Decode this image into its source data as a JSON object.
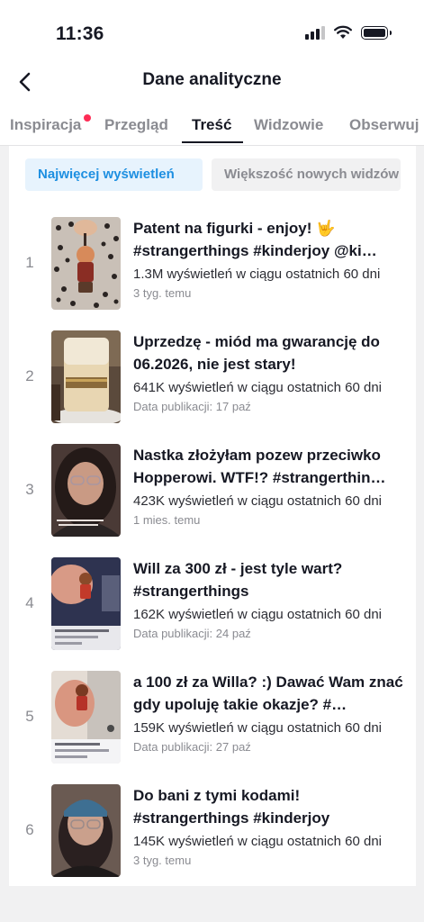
{
  "status": {
    "time": "11:36"
  },
  "header": {
    "title": "Dane analityczne"
  },
  "tabs": [
    {
      "label": "Inspiracja",
      "badge": true
    },
    {
      "label": "Przegląd"
    },
    {
      "label": "Treść",
      "active": true
    },
    {
      "label": "Widzowie"
    },
    {
      "label": "Obserwuj"
    }
  ],
  "filters": {
    "active": "Najwięcej wyświetleń",
    "inactive": "Większość nowych widzów"
  },
  "videos": [
    {
      "rank": "1",
      "title": "Patent na figurki - enjoy! 🤟 #strangerthings #kinderjoy @ki…",
      "views": "1.3M wyświetleń w ciągu ostatnich 60 dni",
      "date": "3 tyg. temu"
    },
    {
      "rank": "2",
      "title": "Uprzedzę - miód ma gwarancję do 06.2026, nie jest stary!",
      "views": "641K wyświetleń w ciągu ostatnich 60 dni",
      "date": "Data publikacji: 17 paź"
    },
    {
      "rank": "3",
      "title": "Nastka złożyłam pozew przeciwko Hopperowi. WTF!? #strangerthin…",
      "views": "423K wyświetleń w ciągu ostatnich 60 dni",
      "date": "1 mies. temu"
    },
    {
      "rank": "4",
      "title": "Will za 300 zł - jest tyle wart? #strangerthings",
      "views": "162K wyświetleń w ciągu ostatnich 60 dni",
      "date": "Data publikacji: 24 paź"
    },
    {
      "rank": "5",
      "title": "a 100 zł za Willa? :) Dawać Wam znać gdy upoluję takie okazje? #…",
      "views": "159K wyświetleń w ciągu ostatnich 60 dni",
      "date": "Data publikacji: 27 paź"
    },
    {
      "rank": "6",
      "title": "Do bani z tymi kodami! #strangerthings #kinderjoy",
      "views": "145K wyświetleń w ciągu ostatnich 60 dni",
      "date": "3 tyg. temu"
    }
  ],
  "colors": {
    "accent": "#1d8fe1",
    "accent_bg": "#e7f3fd",
    "badge": "#fe2c55"
  }
}
